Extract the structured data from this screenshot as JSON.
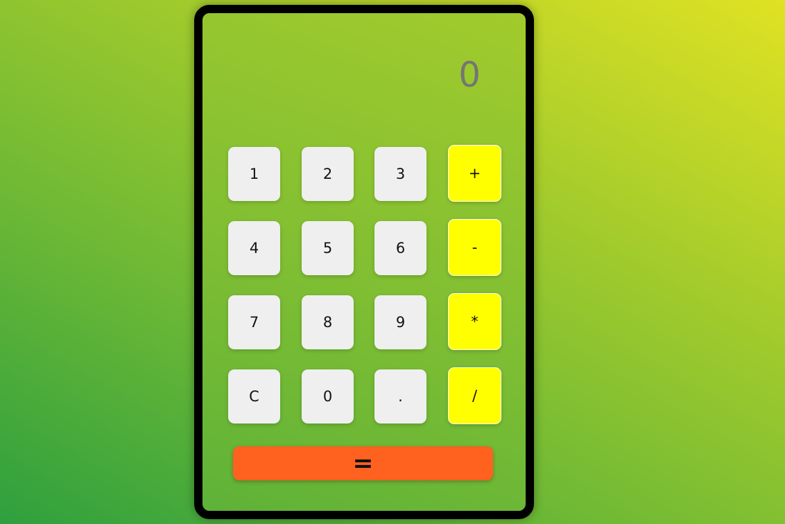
{
  "display": {
    "value": "0"
  },
  "keys": {
    "k1": "1",
    "k2": "2",
    "k3": "3",
    "plus": "+",
    "k4": "4",
    "k5": "5",
    "k6": "6",
    "minus": "-",
    "k7": "7",
    "k8": "8",
    "k9": "9",
    "multiply": "*",
    "clear": "C",
    "k0": "0",
    "dot": ".",
    "divide": "/",
    "equals": "="
  },
  "colors": {
    "number_key": "#efefef",
    "operator_key": "#ffff00",
    "equals_key": "#ff611f",
    "frame": "#000000",
    "display_text": "#757575"
  }
}
